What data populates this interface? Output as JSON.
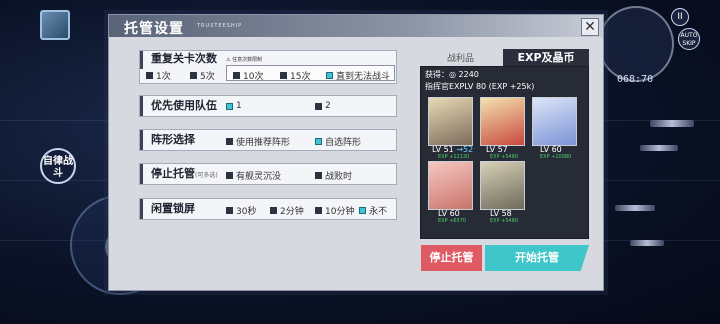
{
  "dialog": {
    "title": "托管设置",
    "subtitle": "TRUSTEESHIP",
    "close_label": "✕"
  },
  "rows": {
    "repeat": {
      "label": "重复关卡次数",
      "notice": "任意次数限制",
      "options": [
        "1次",
        "5次",
        "10次",
        "15次",
        "直到无法战斗"
      ],
      "selected": "直到无法战斗"
    },
    "priority_team": {
      "label": "优先使用队伍",
      "options": [
        "1",
        "2"
      ],
      "selected": "1"
    },
    "formation": {
      "label": "阵形选择",
      "options": [
        "使用推荐阵形",
        "自选阵形"
      ],
      "selected": "自选阵形"
    },
    "stop": {
      "label": "停止托管",
      "label_note": "(可多选)",
      "options": [
        "有舰灵沉没",
        "战败时"
      ]
    },
    "idle_lock": {
      "label": "闲置锁屏",
      "options": [
        "30秒",
        "2分钟",
        "10分钟",
        "永不"
      ],
      "selected": "永不"
    }
  },
  "right_panel": {
    "tab_loot": "战利品",
    "tab_exp": "EXP及晶币",
    "gain_label": "获得：",
    "gain_value": "2240",
    "commander_line": "指挥官EXPLV 80 (EXP +25k)",
    "cards": [
      {
        "lv": "LV 51",
        "lv_up": "52",
        "exp": "EXP +12130"
      },
      {
        "lv": "LV 57",
        "exp": "EXP +5480"
      },
      {
        "lv": "LV 60",
        "exp": "EXP +10080"
      },
      {
        "lv": "LV 60",
        "exp": "EXP +6570"
      },
      {
        "lv": "LV 58",
        "exp": "EXP +5480"
      }
    ]
  },
  "buttons": {
    "stop": "停止托管",
    "start": "开始托管"
  },
  "hud": {
    "auto_battle": "自律战斗",
    "radar_time": "068:70",
    "pause": "II",
    "speed": "AUTO SKIP"
  },
  "colors": {
    "accent_cyan": "#3ec6c8",
    "stop_red": "#e05a63",
    "checked": "#3fc2d6",
    "exp_green": "#4ad46a"
  }
}
